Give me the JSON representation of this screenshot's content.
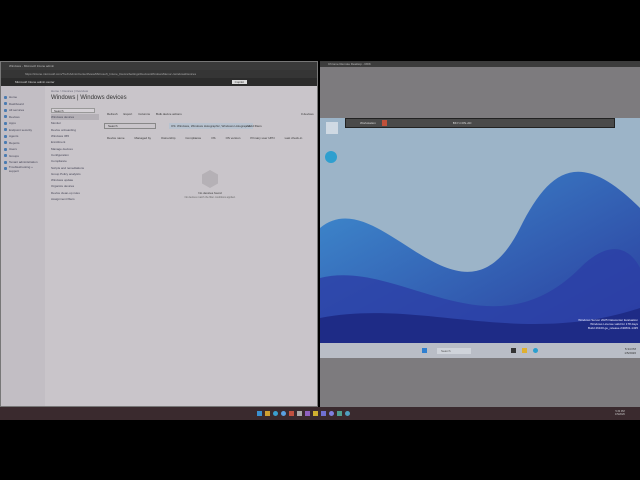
{
  "browser": {
    "tab_title": "Windows - Microsoft Intune admin",
    "url": "https://intune.microsoft.com/?ref=AdminCenter#view/Microsoft_Intune_DeviceSettings/DevicesWindowsMenu/~/windowsDevices",
    "header": "Microsoft Intune admin center",
    "copilot": "Copilot"
  },
  "sidebar": [
    "Home",
    "Dashboard",
    "All services",
    "Devices",
    "Apps",
    "Endpoint security",
    "Agents",
    "Reports",
    "Users",
    "Groups",
    "Tenant administration",
    "Troubleshooting + support"
  ],
  "breadcrumb": "Home > Devices | Overview",
  "page_title": "Windows | Windows devices",
  "nav": {
    "search": "Search",
    "items": [
      "Windows devices",
      "Monitor",
      "Device onboarding",
      "Windows 365",
      "Enrollment",
      "Manage devices",
      "Configuration",
      "Compliance",
      "Scripts and remediations",
      "Group Policy analytics",
      "Windows update",
      "Organize devices",
      "Device clean-up rules",
      "Assignment filters"
    ]
  },
  "toolbar": [
    "Refresh",
    "Export",
    "Columns",
    "Bulk device actions"
  ],
  "device_count": "0 devices",
  "search_placeholder": "Search",
  "filter_chip": "OS: Windows, Windows Holographic, Windows Holographic",
  "add_filters": "+ Add filters",
  "columns": [
    "Device name",
    "Managed by",
    "Ownership",
    "Compliance",
    "OS",
    "OS version",
    "Primary user UPN",
    "Last check-in"
  ],
  "empty": {
    "title": "No devices found",
    "sub": "No devices match the filter conditions applied."
  },
  "crd": {
    "title": "Chrome Remote Desktop - RDK",
    "vm_name": "Workstation",
    "host": "BKY-CON-AD"
  },
  "vm_watermark": [
    "Windows Server 2025 Datacenter Evaluation",
    "Windows License valid for 178 days",
    "Build 26100.ge_release.240831-1435"
  ],
  "vm_taskbar": {
    "search": "Search",
    "time": "5:34 PM",
    "date": "1/5/2026"
  },
  "host_taskbar": {
    "time": "5:34 PM",
    "date": "1/5/2026"
  }
}
